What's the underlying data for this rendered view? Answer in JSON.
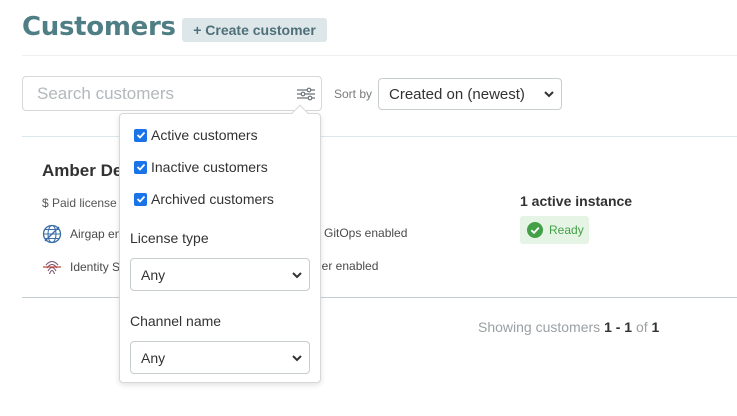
{
  "header": {
    "title": "Customers",
    "create_label": "+ Create customer"
  },
  "search": {
    "placeholder": "Search customers",
    "filter_icon": "sliders-icon"
  },
  "sort": {
    "label": "Sort by",
    "selected": "Created on (newest)"
  },
  "filter_popover": {
    "checkboxes": [
      {
        "label": "Active customers",
        "checked": true
      },
      {
        "label": "Inactive customers",
        "checked": true
      },
      {
        "label": "Archived customers",
        "checked": true
      }
    ],
    "license_type": {
      "label": "License type",
      "selected": "Any"
    },
    "channel_name": {
      "label": "Channel name",
      "selected": "Any"
    }
  },
  "customer": {
    "name": "Amber De",
    "license": "$ Paid license",
    "features": {
      "airgap": {
        "label": "Airgap en",
        "icon": "globe-icon"
      },
      "gitops": {
        "label": "GitOps enabled",
        "icon": "gitops-icon"
      },
      "identity": {
        "label": "Identity S",
        "icon": "fingerprint-icon"
      },
      "provider": {
        "label": "der enabled"
      }
    },
    "instances": "1 active instance",
    "status": {
      "label": "Ready",
      "color": "#43a047"
    }
  },
  "pagination": {
    "prefix": "Showing customers",
    "range": "1 - 1",
    "of": "of",
    "total": "1"
  }
}
